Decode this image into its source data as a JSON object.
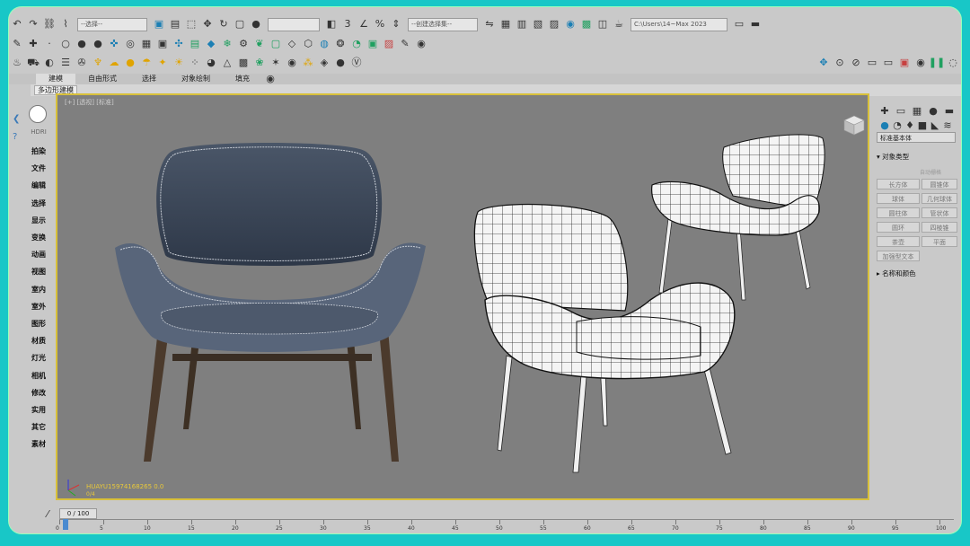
{
  "toolbar": {
    "path_field": "C:\\Users\\14~Max 2023",
    "field1": "--选择--",
    "field2": "--创建选择集--"
  },
  "tabs": [
    {
      "label": "建模",
      "active": true
    },
    {
      "label": "自由形式",
      "active": false
    },
    {
      "label": "选择",
      "active": false
    },
    {
      "label": "对象绘制",
      "active": false
    },
    {
      "label": "填充",
      "active": false
    }
  ],
  "ribbon": {
    "label": "多边形建模"
  },
  "left_panel": {
    "top_label": "HDRI",
    "items": [
      "拍染",
      "文件",
      "编辑",
      "选择",
      "显示",
      "变换",
      "动画",
      "视图",
      "室内",
      "室外",
      "图形",
      "材质",
      "灯光",
      "相机",
      "修改",
      "实用",
      "其它",
      "素材"
    ]
  },
  "viewport": {
    "label": "[+] [透视] [标准]",
    "watermark": "HUAYU15974168265 0.0",
    "sub": "0/4"
  },
  "right_panel": {
    "dropdown": "标准基本体",
    "section1": "▾ 对象类型",
    "autogrid": "自动栅格",
    "buttons": [
      "长方体",
      "圆锥体",
      "球体",
      "几何球体",
      "圆柱体",
      "管状体",
      "圆环",
      "四棱锥",
      "茶壶",
      "平面",
      "加强型文本"
    ],
    "section2": "▸ 名称和颜色"
  },
  "timeline": {
    "frame_range": "0 / 100",
    "ticks": [
      "0",
      "5",
      "10",
      "15",
      "20",
      "25",
      "30",
      "35",
      "40",
      "45",
      "50",
      "55",
      "60",
      "65",
      "70",
      "75",
      "80",
      "85",
      "90",
      "95",
      "100"
    ]
  },
  "colors": {
    "frame_bg": "#18c7c7",
    "viewport_border": "#d8c03a",
    "viewport_bg": "#7f7f7f",
    "chair_fabric": "#3e4a5c",
    "chair_legs": "#4b3a2c"
  }
}
